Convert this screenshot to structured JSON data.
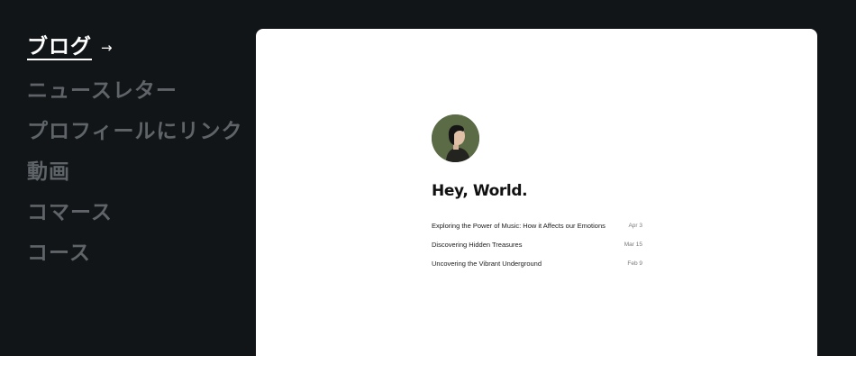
{
  "sidebar": {
    "items": [
      {
        "label": "ブログ",
        "active": true,
        "arrow": "→"
      },
      {
        "label": "ニュースレター",
        "active": false
      },
      {
        "label": "プロフィールにリンク",
        "active": false
      },
      {
        "label": "動画",
        "active": false
      },
      {
        "label": "コマース",
        "active": false
      },
      {
        "label": "コース",
        "active": false
      }
    ]
  },
  "preview": {
    "headline": "Hey, World.",
    "avatar_icon": "person-portrait-icon",
    "posts": [
      {
        "title": "Exploring the Power of Music: How it Affects our Emotions",
        "date": "Apr 3"
      },
      {
        "title": "Discovering Hidden Treasures",
        "date": "Mar 15"
      },
      {
        "title": "Uncovering the Vibrant Underground",
        "date": "Feb 9"
      }
    ]
  },
  "colors": {
    "background": "#111518",
    "nav_active": "#ffffff",
    "nav_inactive": "#5f6468",
    "card": "#ffffff",
    "avatar_bg": "#5a6b46"
  }
}
